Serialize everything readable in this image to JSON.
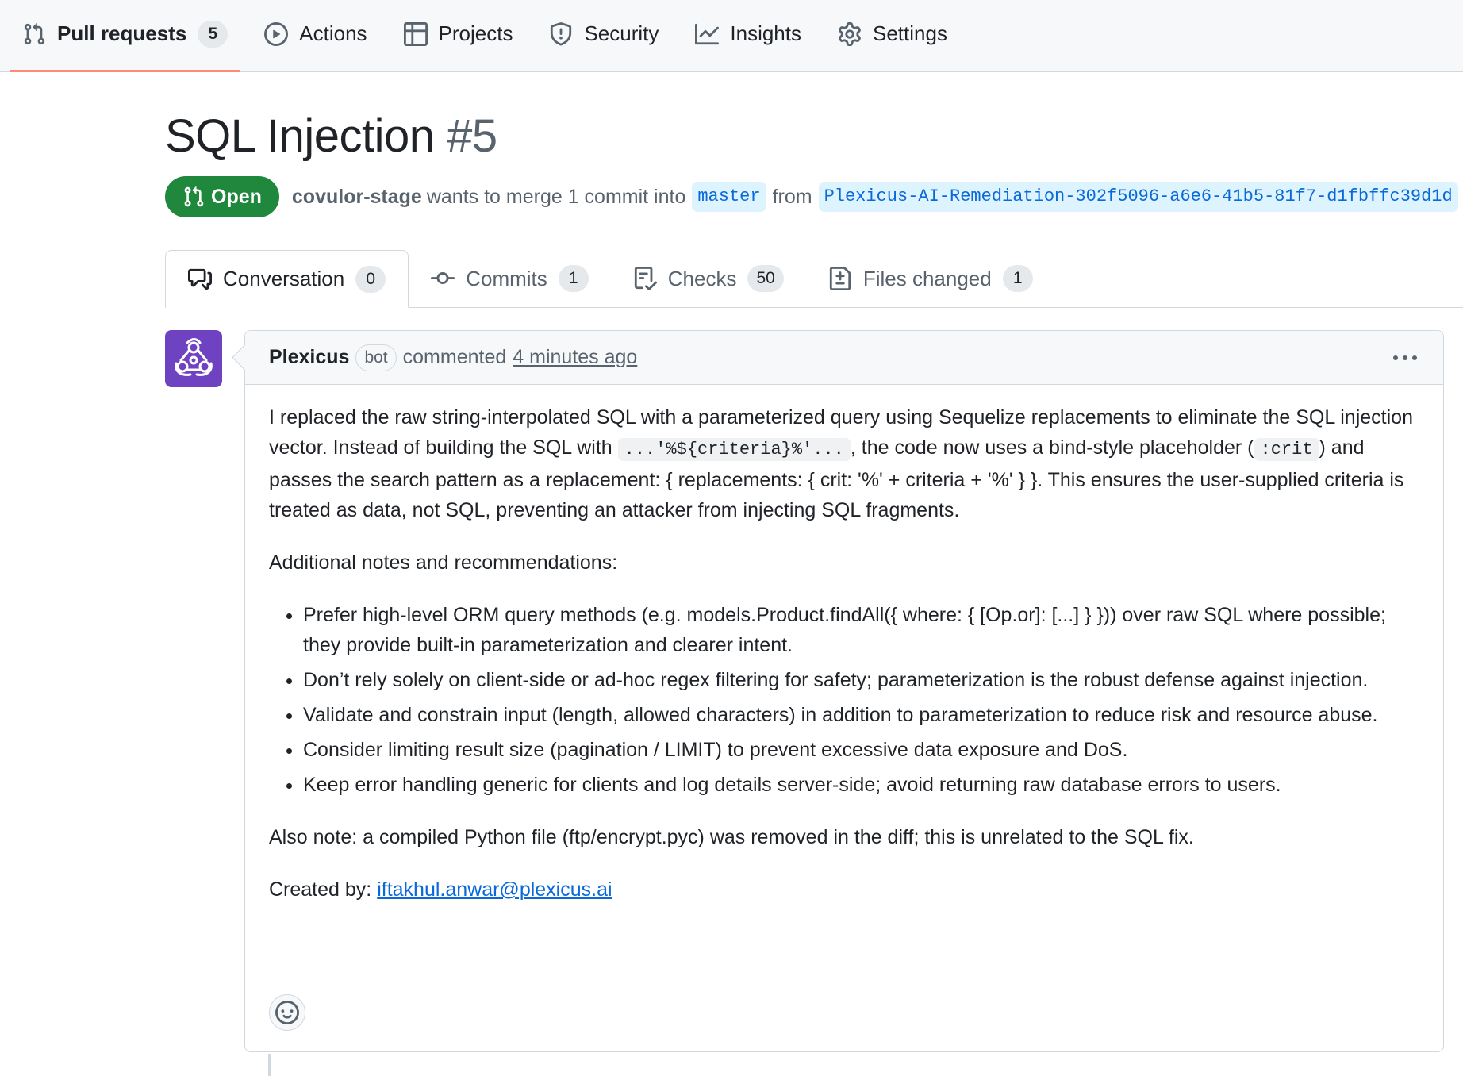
{
  "repo_nav": {
    "items": [
      {
        "label": "Pull requests",
        "count": "5",
        "icon": "git-pull-request-icon",
        "selected": true
      },
      {
        "label": "Actions",
        "icon": "play-icon"
      },
      {
        "label": "Projects",
        "icon": "table-icon"
      },
      {
        "label": "Security",
        "icon": "shield-icon"
      },
      {
        "label": "Insights",
        "icon": "graph-icon"
      },
      {
        "label": "Settings",
        "icon": "gear-icon"
      }
    ]
  },
  "pr": {
    "title": "SQL Injection",
    "number": "#5",
    "state": "Open",
    "author": "covulor-stage",
    "merge_text": "wants to merge 1 commit into",
    "base_branch": "master",
    "from_text": "from",
    "head_branch": "Plexicus-AI-Remediation-302f5096-a6e6-41b5-81f7-d1fbffc39d1d"
  },
  "tabs": [
    {
      "label": "Conversation",
      "count": "0",
      "icon": "comment-discussion-icon",
      "selected": true
    },
    {
      "label": "Commits",
      "count": "1",
      "icon": "git-commit-icon"
    },
    {
      "label": "Checks",
      "count": "50",
      "icon": "checklist-icon"
    },
    {
      "label": "Files changed",
      "count": "1",
      "icon": "file-diff-icon"
    }
  ],
  "comment": {
    "author": "Plexicus",
    "bot_label": "bot",
    "action": "commented",
    "timestamp": "4 minutes ago",
    "para1": {
      "t1": "I replaced the raw string-interpolated SQL with a parameterized query using Sequelize replacements to eliminate the SQL injection vector. Instead of building the SQL with ",
      "code1": "...'%${criteria}%'...",
      "t2": ", the code now uses a bind-style placeholder (",
      "code2": ":crit",
      "t3": ") and passes the search pattern as a replacement: { replacements: { crit: '%' + criteria + '%' } }. This ensures the user-supplied criteria is treated as data, not SQL, preventing an attacker from injecting SQL fragments."
    },
    "para2": "Additional notes and recommendations:",
    "bullets": [
      "Prefer high-level ORM query methods (e.g. models.Product.findAll({ where: { [Op.or]: [...] } })) over raw SQL where possible; they provide built-in parameterization and clearer intent.",
      "Don’t rely solely on client-side or ad-hoc regex filtering for safety; parameterization is the robust defense against injection.",
      "Validate and constrain input (length, allowed characters) in addition to parameterization to reduce risk and resource abuse.",
      "Consider limiting result size (pagination / LIMIT) to prevent excessive data exposure and DoS.",
      "Keep error handling generic for clients and log details server-side; avoid returning raw database errors to users."
    ],
    "para3": "Also note: a compiled Python file (ftp/encrypt.pyc) was removed in the diff; this is unrelated to the SQL fix.",
    "created_by_label": "Created by: ",
    "created_by_email": "iftakhul.anwar@plexicus.ai"
  },
  "colors": {
    "open_green": "#1f883d",
    "link_blue": "#0969da",
    "selected_underline": "#fd8c73",
    "avatar_purple": "#6f42c1"
  }
}
